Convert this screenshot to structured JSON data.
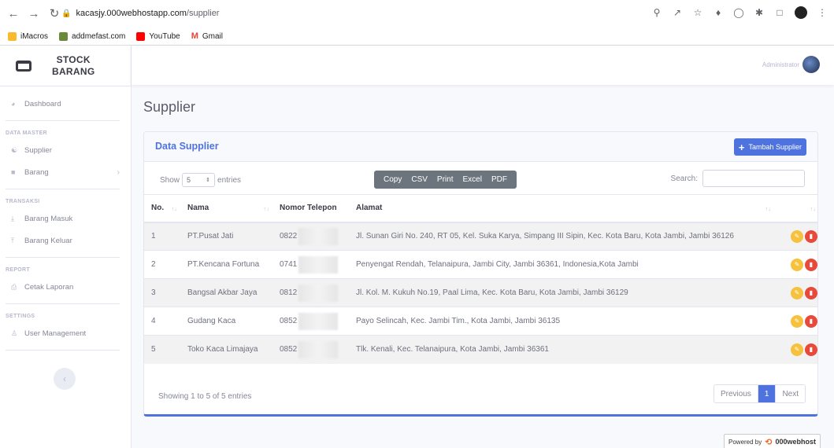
{
  "browser": {
    "url_host": "kacasjy.000webhostapp.com",
    "url_path": "/supplier",
    "bookmarks": [
      {
        "label": "iMacros",
        "color": "#f9bb2d"
      },
      {
        "label": "addmefast.com",
        "color": "#6a8a3a"
      },
      {
        "label": "YouTube",
        "color": "#ff0000"
      },
      {
        "label": "Gmail",
        "color": "#ea4335"
      }
    ]
  },
  "sidebar": {
    "brand_line1": "STOCK",
    "brand_line2": "BARANG",
    "dashboard": "Dashboard",
    "head_master": "DATA MASTER",
    "supplier": "Supplier",
    "barang": "Barang",
    "head_transaksi": "TRANSAKSI",
    "barang_masuk": "Barang Masuk",
    "barang_keluar": "Barang Keluar",
    "head_report": "REPORT",
    "cetak_laporan": "Cetak Laporan",
    "head_settings": "SETTINGS",
    "user_management": "User Management"
  },
  "topbar": {
    "user_name": "Administrator"
  },
  "page": {
    "title": "Supplier"
  },
  "card": {
    "title": "Data Supplier",
    "add_button": "Tambah Supplier",
    "show_label": "Show",
    "show_value": "5",
    "entries_label": "entries",
    "search_label": "Search:",
    "export_buttons": [
      "Copy",
      "CSV",
      "Print",
      "Excel",
      "PDF"
    ],
    "columns": [
      "No.",
      "Nama",
      "Nomor Telepon",
      "Alamat"
    ],
    "rows": [
      {
        "no": "1",
        "nama": "PT.Pusat Jati",
        "telepon": "0822",
        "alamat": "Jl. Sunan Giri No. 240, RT 05, Kel. Suka Karya, Simpang III Sipin, Kec. Kota Baru, Kota Jambi, Jambi 36126"
      },
      {
        "no": "2",
        "nama": "PT.Kencana Fortuna",
        "telepon": "0741",
        "alamat": "Penyengat Rendah, Telanaipura, Jambi City, Jambi 36361, Indonesia,Kota Jambi"
      },
      {
        "no": "3",
        "nama": "Bangsal Akbar Jaya",
        "telepon": "0812",
        "alamat": "Jl. Kol. M. Kukuh No.19, Paal Lima, Kec. Kota Baru, Kota Jambi, Jambi 36129"
      },
      {
        "no": "4",
        "nama": "Gudang Kaca",
        "telepon": "0852",
        "alamat": "Payo Selincah, Kec. Jambi Tim., Kota Jambi, Jambi 36135"
      },
      {
        "no": "5",
        "nama": "Toko Kaca Limajaya",
        "telepon": "0852",
        "alamat": "Tlk. Kenali, Kec. Telanaipura, Kota Jambi, Jambi 36361"
      }
    ],
    "info": "Showing 1 to 5 of 5 entries",
    "pager": {
      "prev": "Previous",
      "current": "1",
      "next": "Next"
    }
  },
  "powered": {
    "prefix": "Powered by",
    "brand": "000webhost"
  }
}
